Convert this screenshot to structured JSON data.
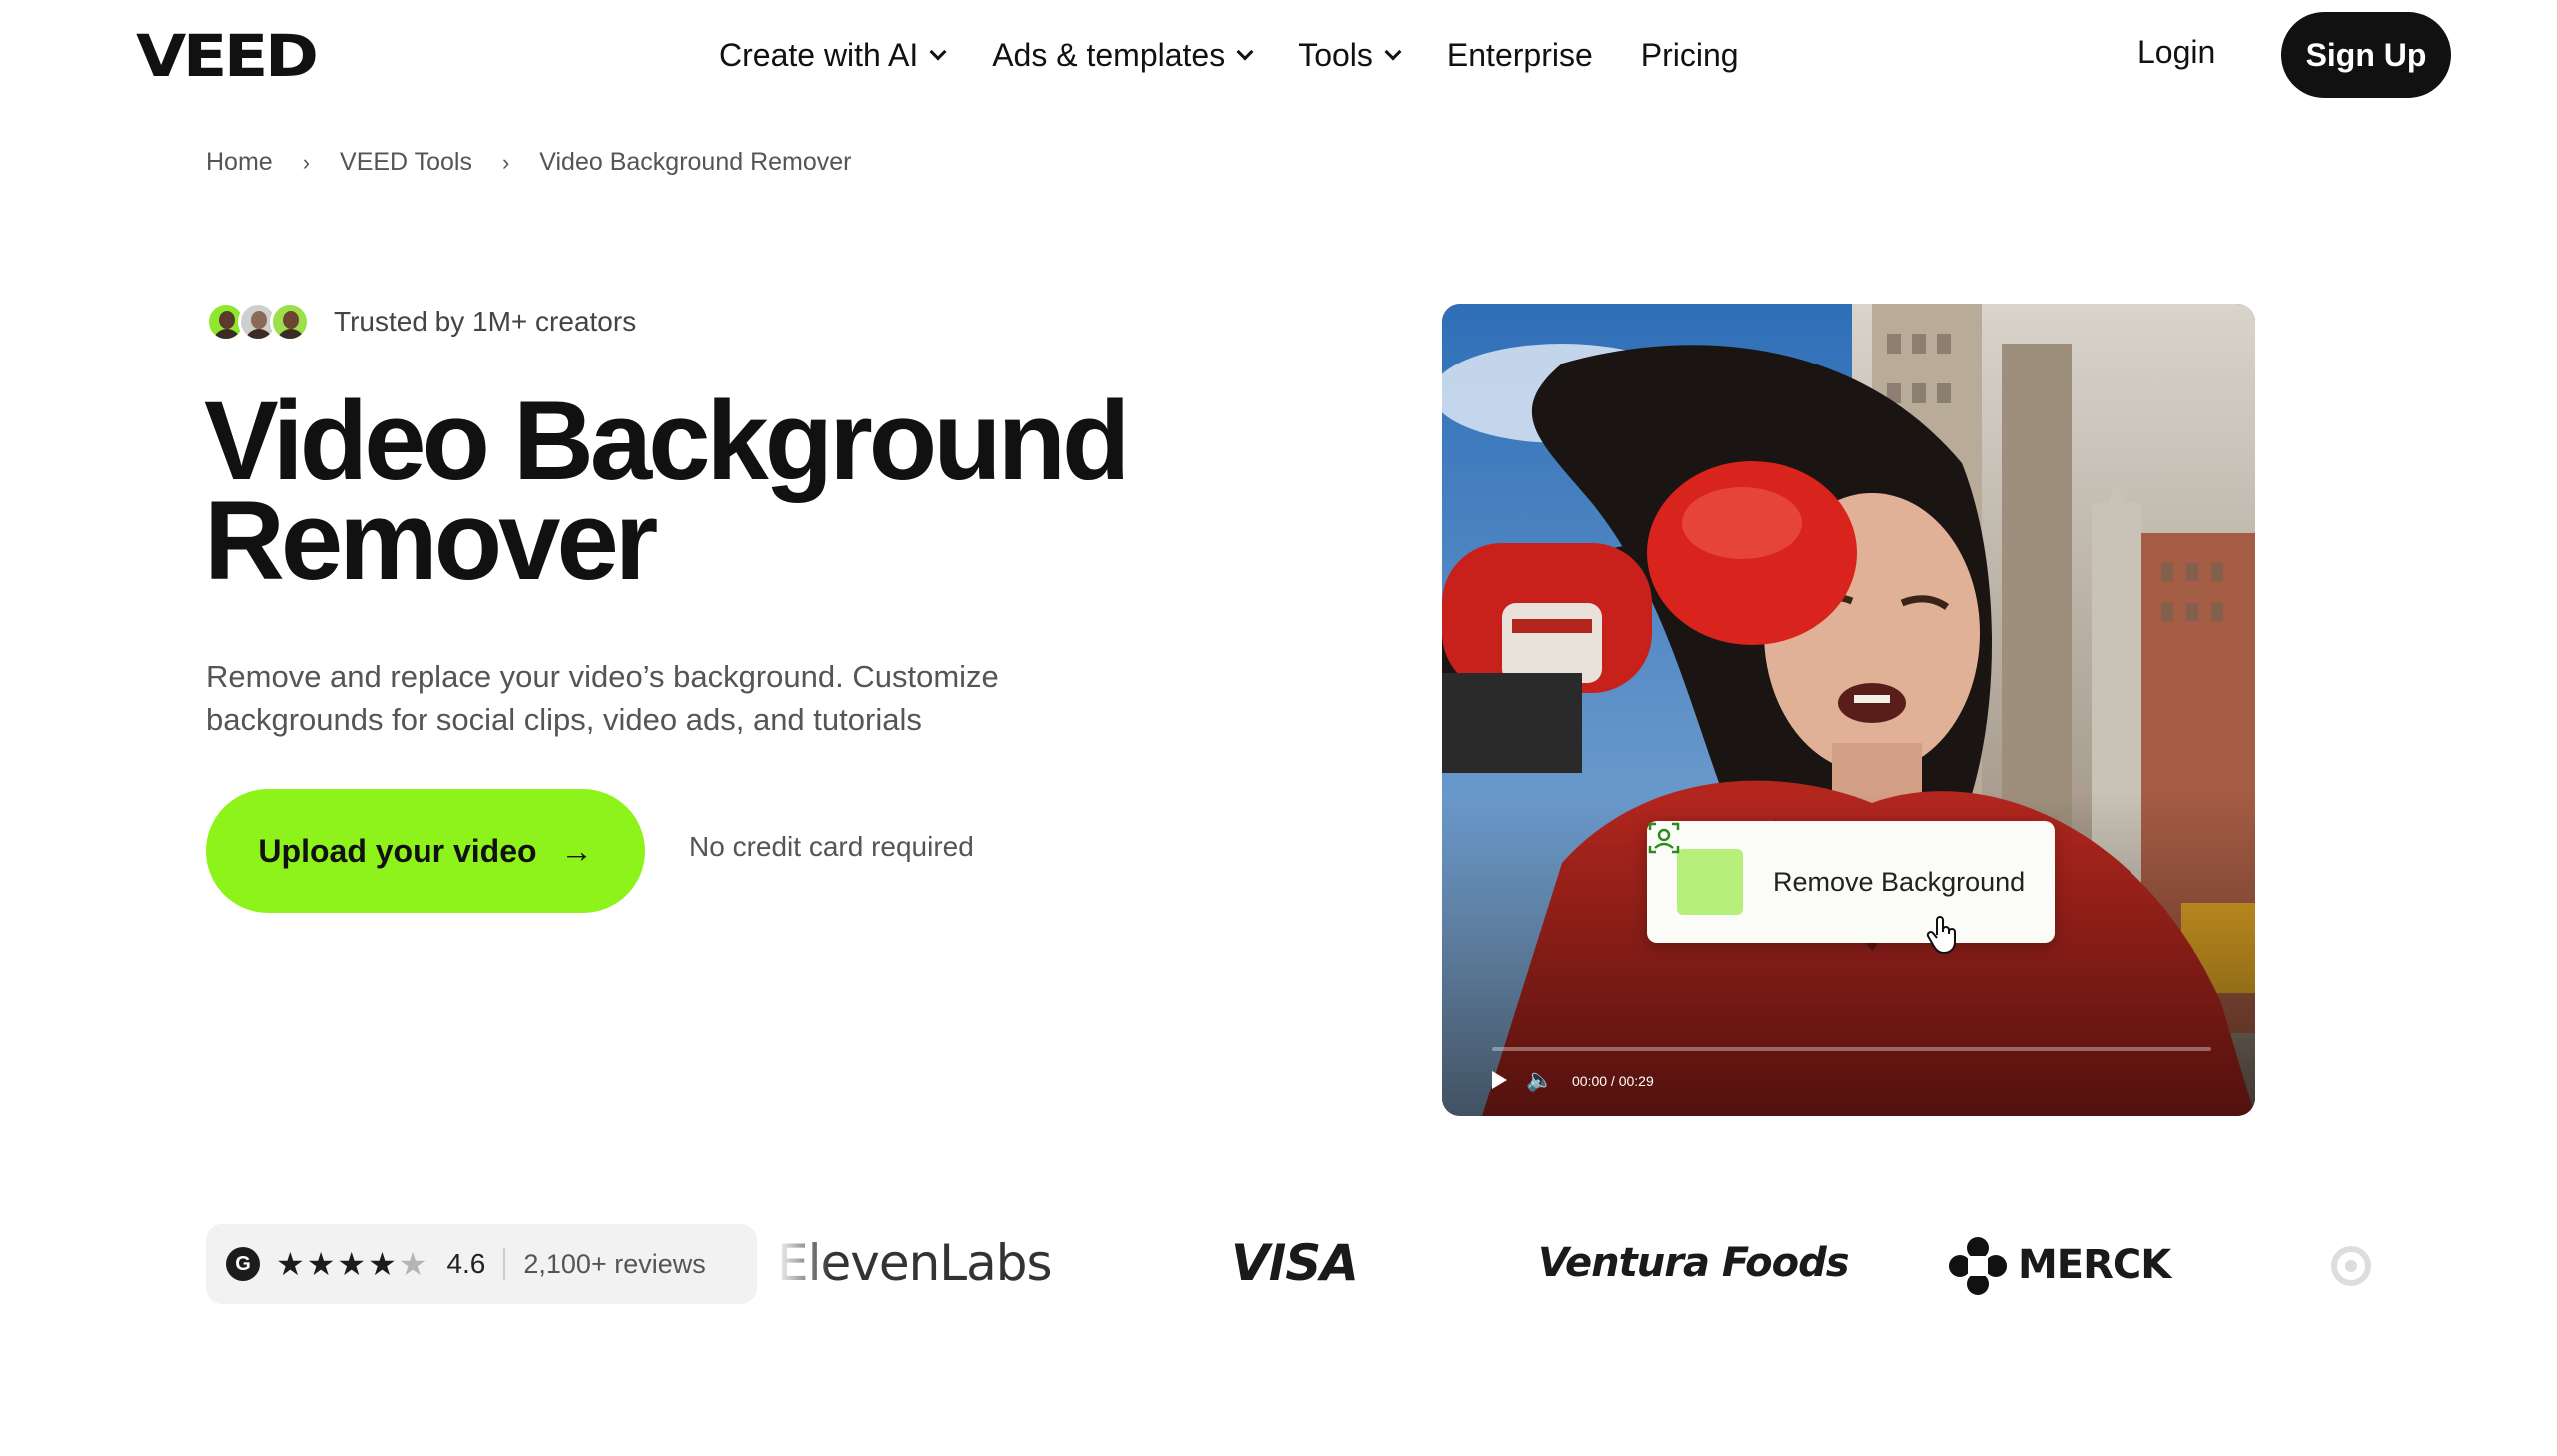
{
  "header": {
    "logo": "VEED",
    "nav": [
      {
        "label": "Create with AI",
        "has_dropdown": true
      },
      {
        "label": "Ads & templates",
        "has_dropdown": true
      },
      {
        "label": "Tools",
        "has_dropdown": true
      },
      {
        "label": "Enterprise",
        "has_dropdown": false
      },
      {
        "label": "Pricing",
        "has_dropdown": false
      }
    ],
    "login_label": "Login",
    "signup_label": "Sign Up"
  },
  "breadcrumb": {
    "items": [
      "Home",
      "VEED Tools",
      "Video Background Remover"
    ],
    "separator": "›"
  },
  "hero": {
    "trust_text": "Trusted by 1M+ creators",
    "title_line1": "Video Background",
    "title_line2": "Remover",
    "subtitle": "Remove and replace your video’s background. Customize backgrounds for social clips, video ads, and tutorials",
    "cta_label": "Upload your video",
    "cta_arrow": "→",
    "note": "No credit card required"
  },
  "media": {
    "action_label": "Remove Background",
    "action_icon": "person-frame-icon",
    "time_readout": "00:00 / 00:29",
    "play_icon": "play-icon",
    "volume_icon": "volume-icon"
  },
  "social_proof": {
    "rating_badge": "G",
    "stars": "★★★★",
    "half_star": "★",
    "score": "4.6",
    "reviews": "2,100+ reviews",
    "brands": [
      "ElevenLabs",
      "VISA",
      "Ventura Foods",
      "MERCK"
    ]
  },
  "colors": {
    "accent_green": "#8ef31b",
    "dark": "#111111",
    "muted_text": "#555555"
  }
}
